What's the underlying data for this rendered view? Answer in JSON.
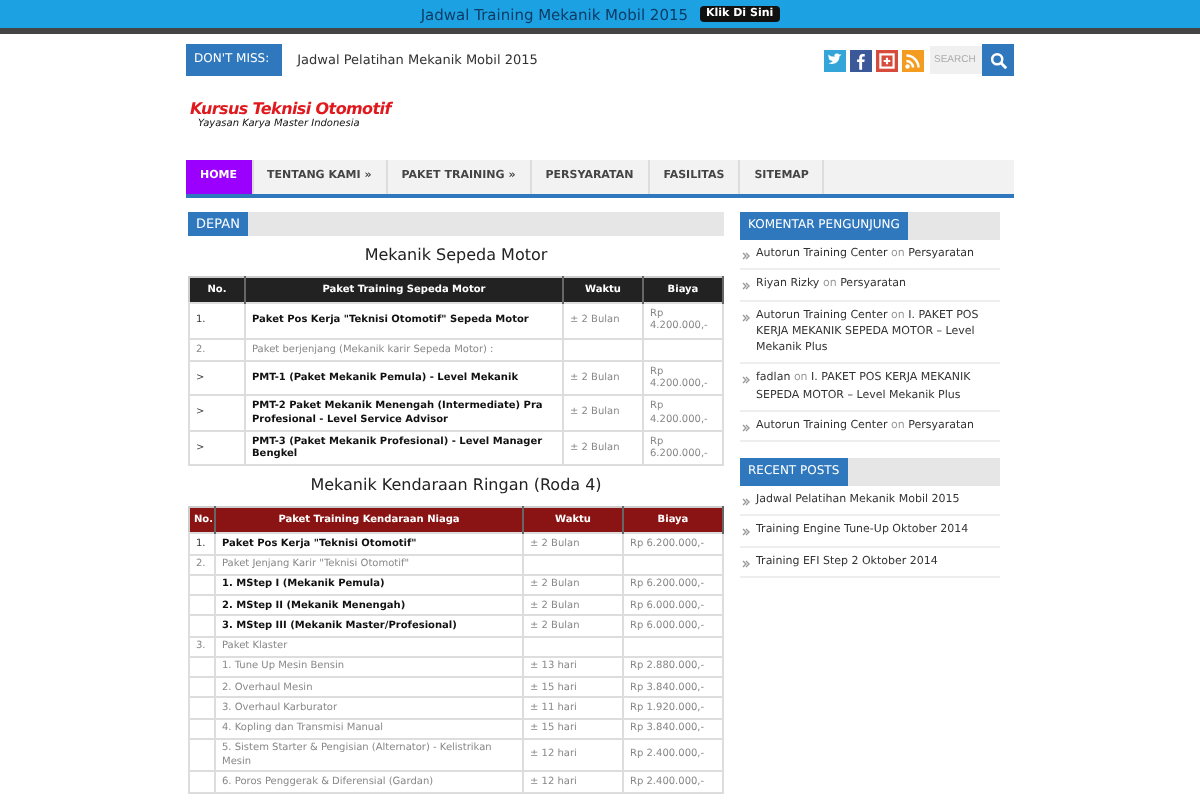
{
  "top_bar": {
    "text": "Jadwal Training Mekanik Mobil 2015",
    "button": "Klik Di Sini"
  },
  "ticker": {
    "label": "DON'T MISS:",
    "text": "Jadwal Pelatihan Mekanik Mobil 2015"
  },
  "search": {
    "placeholder": "SEARCH"
  },
  "logo": {
    "title": "Kursus Teknisi Otomotif",
    "subtitle": "Yayasan Karya Master Indonesia"
  },
  "nav": [
    {
      "label": "HOME",
      "selected": true
    },
    {
      "label": "TENTANG KAMI »",
      "selected": false
    },
    {
      "label": "PAKET TRAINING »",
      "selected": false
    },
    {
      "label": "PERSYARATAN",
      "selected": false
    },
    {
      "label": "FASILITAS",
      "selected": false
    },
    {
      "label": "SITEMAP",
      "selected": false
    }
  ],
  "breadcrumb": "DEPAN",
  "tables": [
    {
      "title": "Mekanik Sepeda Motor",
      "kind": "dark",
      "columns": [
        "No.",
        "Paket Training Sepeda Motor",
        "Waktu",
        "Biaya"
      ],
      "rows": [
        {
          "strong": true,
          "cells": [
            "1.",
            "Paket Pos Kerja \"Teknisi Otomotif\" Sepeda Motor",
            "± 2 Bulan",
            "Rp 4.200.000,-"
          ]
        },
        {
          "strong": false,
          "cells": [
            "2.",
            "Paket berjenjang (Mekanik karir Sepeda Motor) :",
            "",
            ""
          ]
        },
        {
          "strong": true,
          "cells": [
            ">",
            "PMT-1 (Paket Mekanik Pemula) - Level Mekanik",
            "± 2 Bulan",
            "Rp 4.200.000,-"
          ]
        },
        {
          "strong": true,
          "cells": [
            ">",
            "PMT-2 Paket Mekanik Menengah (Intermediate) Pra Profesional - Level Service Advisor",
            "± 2 Bulan",
            "Rp 4.200.000,-"
          ]
        },
        {
          "strong": true,
          "cells": [
            ">",
            "PMT-3 (Paket Mekanik Profesional) - Level Manager Bengkel",
            "± 2 Bulan",
            "Rp 6.200.000,-"
          ]
        }
      ]
    },
    {
      "title": "Mekanik Kendaraan Ringan (Roda 4)",
      "kind": "red",
      "columns": [
        "No.",
        "Paket Training Kendaraan Niaga",
        "Waktu",
        "Biaya"
      ],
      "rows": [
        {
          "strong": true,
          "cells": [
            "1.",
            "Paket Pos Kerja \"Teknisi Otomotif\"",
            "± 2 Bulan",
            "Rp 6.200.000,-"
          ]
        },
        {
          "strong": false,
          "cells": [
            "2.",
            "Paket Jenjang Karir \"Teknisi Otomotif\"",
            "",
            ""
          ]
        },
        {
          "strong": true,
          "cells": [
            "",
            "1. MStep I (Mekanik Pemula)",
            "± 2 Bulan",
            "Rp 6.200.000,-"
          ]
        },
        {
          "strong": true,
          "cells": [
            "",
            "2. MStep II (Mekanik Menengah)",
            "± 2 Bulan",
            "Rp 6.000.000,-"
          ]
        },
        {
          "strong": true,
          "cells": [
            "",
            "3. MStep III (Mekanik Master/Profesional)",
            "± 2 Bulan",
            "Rp 6.000.000,-"
          ]
        },
        {
          "strong": false,
          "cells": [
            "3.",
            "Paket Klaster",
            "",
            ""
          ]
        },
        {
          "strong": false,
          "cells": [
            "",
            "1. Tune Up Mesin Bensin",
            "± 13 hari",
            "Rp 2.880.000,-"
          ]
        },
        {
          "strong": false,
          "cells": [
            "",
            "2. Overhaul Mesin",
            "± 15 hari",
            "Rp 3.840.000,-"
          ]
        },
        {
          "strong": false,
          "cells": [
            "",
            "3. Overhaul Karburator",
            "± 11 hari",
            "Rp 1.920.000,-"
          ]
        },
        {
          "strong": false,
          "cells": [
            "",
            "4. Kopling dan Transmisi Manual",
            "± 15 hari",
            "Rp 3.840.000,-"
          ]
        },
        {
          "strong": false,
          "cells": [
            "",
            "5. Sistem Starter & Pengisian (Alternator) - Kelistrikan Mesin",
            "± 12 hari",
            "Rp 2.400.000,-"
          ]
        },
        {
          "strong": false,
          "cells": [
            "",
            "6. Poros Penggerak & Diferensial (Gardan)",
            "± 12 hari",
            "Rp 2.400.000,-"
          ]
        }
      ]
    }
  ],
  "comments": {
    "title": "KOMENTAR PENGUNJUNG",
    "items": [
      {
        "author": "Autorun Training Center",
        "on": "on",
        "post": "Persyaratan"
      },
      {
        "author": "Riyan Rizky",
        "on": "on",
        "post": "Persyaratan"
      },
      {
        "author": "Autorun Training Center",
        "on": "on",
        "post": "I. PAKET POS KERJA MEKANIK SEPEDA MOTOR – Level Mekanik Plus"
      },
      {
        "author": "fadlan",
        "on": "on",
        "post": "I. PAKET POS KERJA MEKANIK SEPEDA MOTOR – Level Mekanik Plus"
      },
      {
        "author": "Autorun Training Center",
        "on": "on",
        "post": "Persyaratan"
      }
    ]
  },
  "recent": {
    "title": "RECENT POSTS",
    "items": [
      "Jadwal Pelatihan Mekanik Mobil 2015",
      "Training Engine Tune-Up Oktober 2014",
      "Training EFI Step 2 Oktober 2014"
    ]
  }
}
